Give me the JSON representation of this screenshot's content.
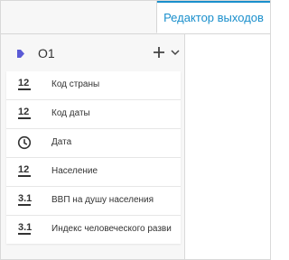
{
  "tab": {
    "label": "Редактор выходов"
  },
  "group": {
    "title": "O1"
  },
  "items": [
    {
      "type_label": "12",
      "icon": "integer-type-icon",
      "label": "Код страны"
    },
    {
      "type_label": "12",
      "icon": "integer-type-icon",
      "label": "Код даты"
    },
    {
      "type_label": "",
      "icon": "clock-icon",
      "label": "Дата"
    },
    {
      "type_label": "12",
      "icon": "integer-type-icon",
      "label": "Население"
    },
    {
      "type_label": "3.1",
      "icon": "decimal-type-icon",
      "label": "ВВП на душу населения"
    },
    {
      "type_label": "3.1",
      "icon": "decimal-type-icon",
      "label": "Индекс человеческого разви"
    }
  ],
  "colors": {
    "accent": "#1a8fcc",
    "output_icon": "#5b5bd6"
  }
}
